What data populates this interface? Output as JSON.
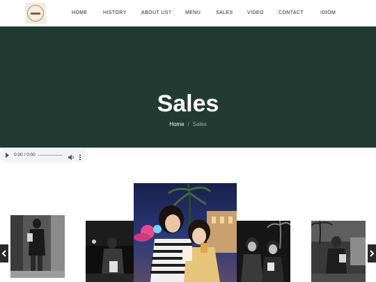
{
  "nav": {
    "logo_icon": "restaurant-logo",
    "links": [
      "HOME",
      "HISTORY",
      "ABOUT US?",
      "MENU",
      "SALES",
      "VIDEO",
      "CONTACT",
      "IDIOM"
    ]
  },
  "hero": {
    "title": "Sales",
    "breadcrumb": {
      "home": "Home",
      "separator": "/",
      "current": "Sales"
    },
    "background_color": "#213b32"
  },
  "audio_player": {
    "time": "0:00 / 0:00",
    "icons": [
      "play-icon",
      "volume-icon",
      "more-options-icon"
    ]
  },
  "gallery": {
    "photos": [
      "photo-1",
      "photo-2",
      "photo-3",
      "photo-4",
      "photo-5"
    ],
    "prev_icon": "chevron-left-icon",
    "next_icon": "chevron-right-icon"
  }
}
